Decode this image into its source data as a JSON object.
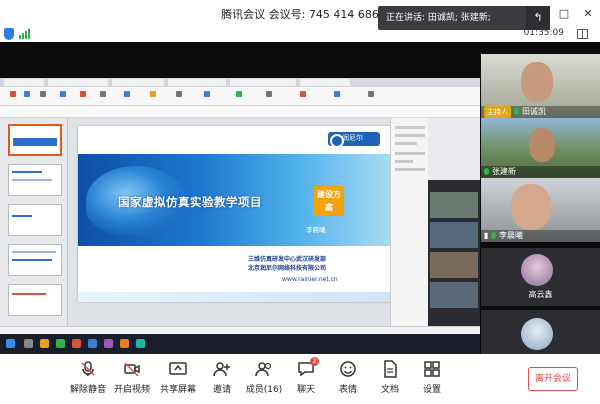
{
  "window": {
    "title": "腾讯会议 会议号: 745 414 686",
    "controls": [
      "—",
      "□",
      "✕"
    ]
  },
  "speaker_banner": {
    "text": "正在讲话: 田诚凯; 张建新;"
  },
  "meeting": {
    "timer": "01:35:09"
  },
  "slide": {
    "logo_text": "润尼尔",
    "title": "国家虚拟仿真实验教学项目",
    "tag": "建设方案",
    "author": "李晨曦",
    "org_line1": "三维仿真研发中心武汉研发部",
    "org_line2": "北京润尼尔网络科技有限公司",
    "url": "www.rainier.net.cn"
  },
  "participants": [
    {
      "name": "田诚凯",
      "role": "主持人"
    },
    {
      "name": "张建新"
    },
    {
      "name": "李晨曦"
    },
    {
      "name": "高云鑫"
    }
  ],
  "toolbar": {
    "items": [
      {
        "label": "解除静音"
      },
      {
        "label": "开启视频"
      },
      {
        "label": "共享屏幕"
      },
      {
        "label": "邀请"
      },
      {
        "label": "成员(16)"
      },
      {
        "label": "聊天",
        "badge": "2"
      },
      {
        "label": "表情"
      },
      {
        "label": "文档"
      },
      {
        "label": "设置"
      }
    ],
    "leave_label": "离开会议"
  },
  "colors": {
    "accent_blue": "#2f7de1",
    "leave_red": "#e04b4b",
    "host_badge": "#e2a516",
    "signal_green": "#2fb34a"
  }
}
